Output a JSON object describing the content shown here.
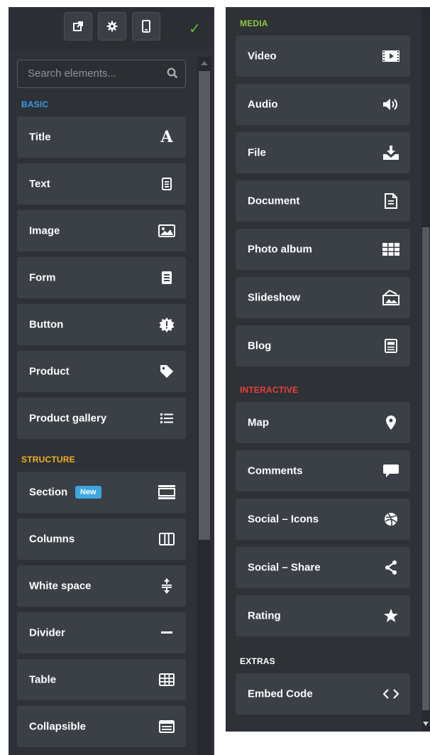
{
  "toolbar": {
    "buttons": [
      {
        "icon": "external-link-icon"
      },
      {
        "icon": "gear-icon"
      },
      {
        "icon": "mobile-icon"
      }
    ],
    "status_icon": "checkmark-icon"
  },
  "search": {
    "placeholder": "Search elements..."
  },
  "colors": {
    "basic": "#3d9be9",
    "structure": "#f2b01e",
    "media": "#8cc63f",
    "interactive": "#e8403a",
    "extras": "#ffffff"
  },
  "categories": {
    "basic": {
      "label": "BASIC",
      "items": [
        {
          "label": "Title",
          "icon": "title-icon"
        },
        {
          "label": "Text",
          "icon": "text-icon"
        },
        {
          "label": "Image",
          "icon": "image-icon"
        },
        {
          "label": "Form",
          "icon": "form-icon"
        },
        {
          "label": "Button",
          "icon": "button-icon"
        },
        {
          "label": "Product",
          "icon": "tag-icon"
        },
        {
          "label": "Product gallery",
          "icon": "list-icon"
        }
      ]
    },
    "structure": {
      "label": "STRUCTURE",
      "items": [
        {
          "label": "Section",
          "icon": "section-icon",
          "badge": "New"
        },
        {
          "label": "Columns",
          "icon": "columns-icon"
        },
        {
          "label": "White space",
          "icon": "white-space-icon"
        },
        {
          "label": "Divider",
          "icon": "divider-icon"
        },
        {
          "label": "Table",
          "icon": "table-icon"
        },
        {
          "label": "Collapsible",
          "icon": "collapsible-icon"
        }
      ]
    },
    "media": {
      "label": "MEDIA",
      "items": [
        {
          "label": "Video",
          "icon": "video-icon"
        },
        {
          "label": "Audio",
          "icon": "audio-icon"
        },
        {
          "label": "File",
          "icon": "download-icon"
        },
        {
          "label": "Document",
          "icon": "document-icon"
        },
        {
          "label": "Photo album",
          "icon": "grid-icon"
        },
        {
          "label": "Slideshow",
          "icon": "slideshow-icon"
        },
        {
          "label": "Blog",
          "icon": "blog-icon"
        }
      ]
    },
    "interactive": {
      "label": "INTERACTIVE",
      "items": [
        {
          "label": "Map",
          "icon": "map-pin-icon"
        },
        {
          "label": "Comments",
          "icon": "comment-icon"
        },
        {
          "label": "Social – Icons",
          "icon": "social-icons-icon"
        },
        {
          "label": "Social – Share",
          "icon": "share-icon"
        },
        {
          "label": "Rating",
          "icon": "star-icon"
        }
      ]
    },
    "extras": {
      "label": "EXTRAS",
      "items": [
        {
          "label": "Embed Code",
          "icon": "code-icon"
        }
      ]
    }
  }
}
